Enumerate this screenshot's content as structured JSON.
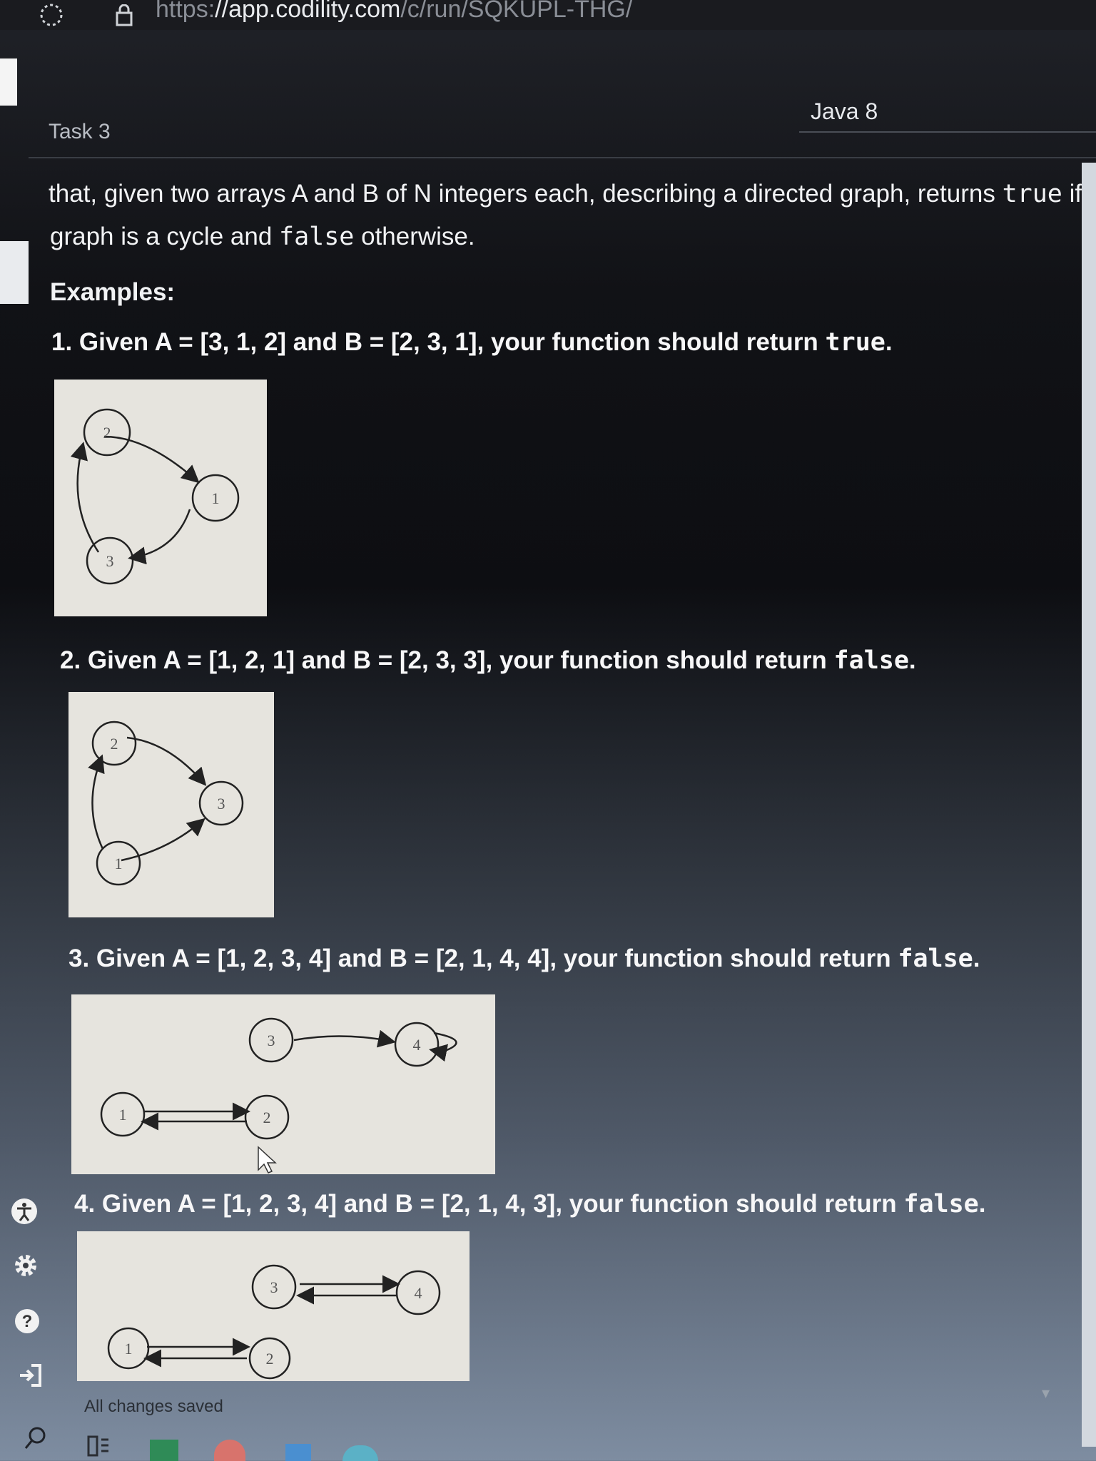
{
  "browser": {
    "url_scheme": "https:",
    "url_host": "//app.codility.com",
    "url_path": "/c/run/SQKUPL-THG/"
  },
  "header": {
    "task_title": "Task 3",
    "language": "Java 8"
  },
  "description": {
    "intro_1_pre": "that, given two arrays A and B of N integers each, describing a directed graph, returns ",
    "intro_1_code": "true",
    "intro_1_post": " if the",
    "intro_2_pre": "graph is a cycle and ",
    "intro_2_code": "false",
    "intro_2_post": " otherwise.",
    "examples_heading": "Examples:"
  },
  "examples": [
    {
      "text": "1. Given A = [3, 1, 2] and B = [2, 3, 1], your function should return ",
      "code": "true",
      "end": ".",
      "nodes": [
        "2",
        "1",
        "3"
      ]
    },
    {
      "text": "2. Given A = [1, 2, 1] and B = [2, 3, 3], your function should return ",
      "code": "false",
      "end": ".",
      "nodes": [
        "2",
        "3",
        "1"
      ]
    },
    {
      "text": "3. Given A = [1, 2, 3, 4] and B = [2, 1, 4, 4], your function should return ",
      "code": "false",
      "end": ".",
      "nodes": [
        "3",
        "4",
        "1",
        "2"
      ]
    },
    {
      "text": "4. Given A = [1, 2, 3, 4] and B = [2, 1, 4, 3], your function should return ",
      "code": "false",
      "end": ".",
      "nodes": [
        "3",
        "4",
        "1",
        "2"
      ]
    }
  ],
  "status": "All changes saved",
  "icons": {
    "reload": "reload-icon",
    "lock": "lock-icon",
    "accessibility": "accessibility-icon",
    "settings": "settings-icon",
    "help": "help-icon",
    "exit": "exit-icon",
    "search": "search-icon",
    "help_glyph": "?"
  }
}
